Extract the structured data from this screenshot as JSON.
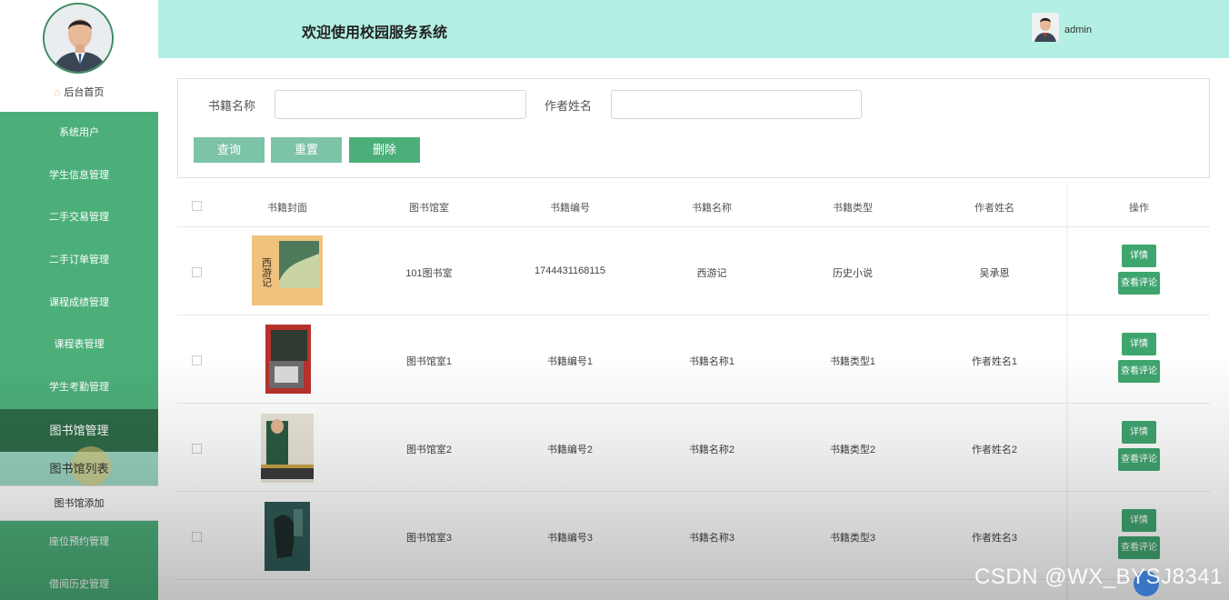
{
  "header": {
    "title": "欢迎使用校园服务系统",
    "username": "admin"
  },
  "sidebar": {
    "home_label": "后台首页",
    "items": [
      {
        "label": "系统用户"
      },
      {
        "label": "学生信息管理"
      },
      {
        "label": "二手交易管理"
      },
      {
        "label": "二手订单管理"
      },
      {
        "label": "课程成绩管理"
      },
      {
        "label": "课程表管理"
      },
      {
        "label": "学生考勤管理"
      },
      {
        "label": "图书馆管理"
      },
      {
        "label": "座位预约管理"
      },
      {
        "label": "借阅历史管理"
      }
    ],
    "sub_items": [
      {
        "label": "图书馆列表"
      },
      {
        "label": "图书馆添加"
      }
    ]
  },
  "search": {
    "book_name_label": "书籍名称",
    "book_name_value": "",
    "author_label": "作者姓名",
    "author_value": "",
    "query_label": "查询",
    "reset_label": "重置",
    "delete_label": "删除"
  },
  "table": {
    "headers": [
      "书籍封面",
      "图书馆室",
      "书籍编号",
      "书籍名称",
      "书籍类型",
      "作者姓名",
      "操作"
    ],
    "rows": [
      {
        "room": "101图书室",
        "code": "1744431168115",
        "name": "西游记",
        "type": "历史小说",
        "author": "吴承恩",
        "cover_title": "西游记"
      },
      {
        "room": "图书馆室1",
        "code": "书籍编号1",
        "name": "书籍名称1",
        "type": "书籍类型1",
        "author": "作者姓名1"
      },
      {
        "room": "图书馆室2",
        "code": "书籍编号2",
        "name": "书籍名称2",
        "type": "书籍类型2",
        "author": "作者姓名2"
      },
      {
        "room": "图书馆室3",
        "code": "书籍编号3",
        "name": "书籍名称3",
        "type": "书籍类型3",
        "author": "作者姓名3"
      }
    ],
    "detail_label": "详情",
    "comment_label": "查看评论"
  },
  "watermark": "CSDN @WX_BYSJ8341",
  "colors": {
    "sidebar": "#4caf7a",
    "sidebar_active": "#2e6b48",
    "header": "#b3efe3",
    "button": "#3fa56f"
  }
}
